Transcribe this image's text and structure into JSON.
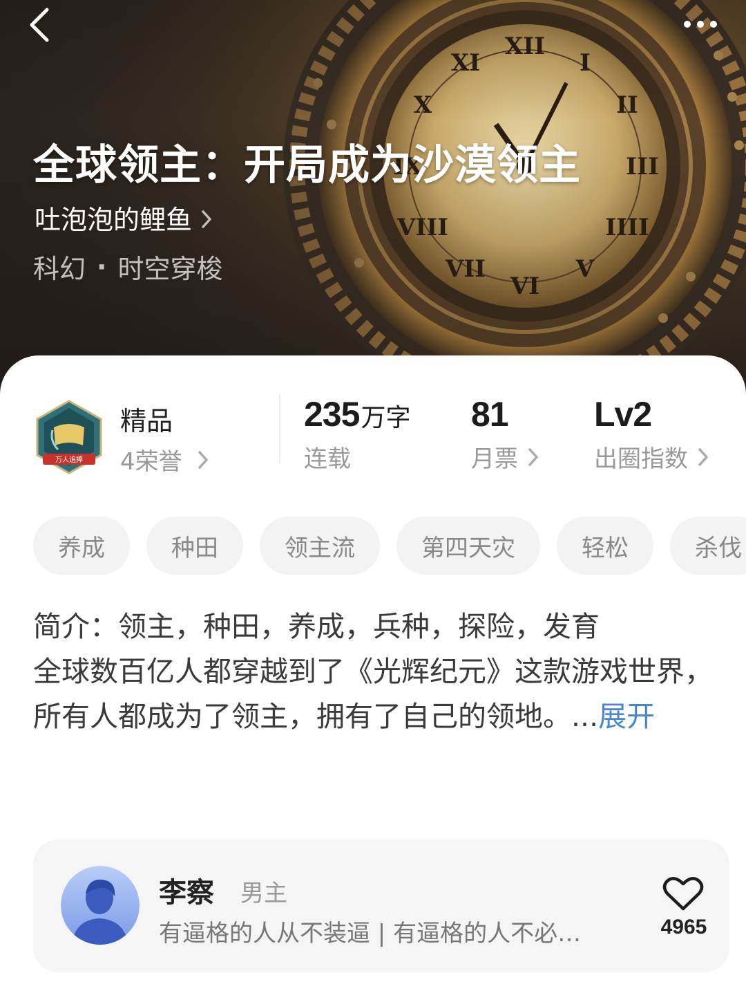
{
  "header": {
    "back_icon": "chevron-left-icon",
    "more_icon": "more-horizontal-icon"
  },
  "book": {
    "title": "全球领主：开局成为沙漠领主",
    "author": "吐泡泡的鲤鱼",
    "category": "科幻",
    "separator": "·",
    "subcategory": "时空穿梭"
  },
  "stats": {
    "honor_badge_icon": "honor-badge-icon",
    "honor_title": "精品",
    "honor_sub": "4荣誉",
    "word_count": "235",
    "word_unit": "万字",
    "status": "连载",
    "monthly_votes": "81",
    "monthly_votes_label": "月票",
    "level": "Lv2",
    "level_label": "出圈指数"
  },
  "tags": [
    "养成",
    "种田",
    "领主流",
    "第四天灾",
    "轻松",
    "杀伐"
  ],
  "intro": {
    "label": "简介：",
    "line1": "领主，种田，养成，兵种，探险，发育",
    "body": "全球数百亿人都穿越到了《光辉纪元》这款游戏世界，所有人都成为了领主，拥有了自己的领地。...",
    "expand": "展开"
  },
  "character": {
    "name": "李察",
    "role": "男主",
    "quote": "有逼格的人从不装逼 | 有逼格的人不必…",
    "likes": "4965",
    "like_icon": "heart-outline-icon"
  },
  "colors": {
    "link": "#4a86cf",
    "tag_bg": "#f3f3f3",
    "card_bg": "#f5f5f5",
    "hero_base": "#3c2f22"
  }
}
